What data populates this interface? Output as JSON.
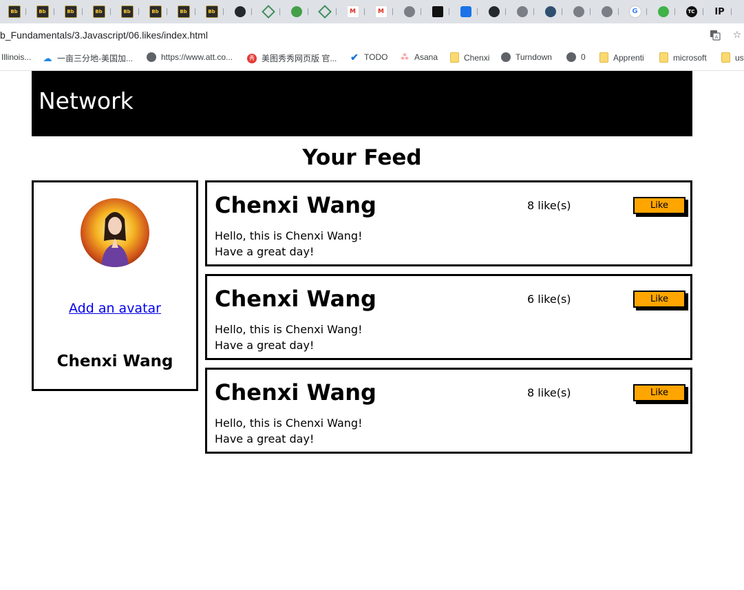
{
  "browser": {
    "tabs": [
      {
        "icon": "blackboard-icon",
        "label": "Bb"
      },
      {
        "icon": "blackboard-icon",
        "label": "Bb"
      },
      {
        "icon": "blackboard-icon",
        "label": "Bb"
      },
      {
        "icon": "blackboard-icon",
        "label": "Bb"
      },
      {
        "icon": "blackboard-icon",
        "label": "Bb"
      },
      {
        "icon": "blackboard-icon",
        "label": "Bb"
      },
      {
        "icon": "blackboard-icon",
        "label": "Bb"
      },
      {
        "icon": "blackboard-icon",
        "label": "Bb"
      },
      {
        "icon": "github-icon",
        "label": ""
      },
      {
        "icon": "diamond-icon",
        "label": ""
      },
      {
        "icon": "green-circle-icon",
        "label": ""
      },
      {
        "icon": "diamond-icon",
        "label": ""
      },
      {
        "icon": "gmail-icon",
        "label": "M"
      },
      {
        "icon": "gmail-icon",
        "label": "M"
      },
      {
        "icon": "globe-icon",
        "label": ""
      },
      {
        "icon": "black-square-icon",
        "label": ""
      },
      {
        "icon": "blue-stack-icon",
        "label": ""
      },
      {
        "icon": "github-icon",
        "label": ""
      },
      {
        "icon": "globe-icon",
        "label": ""
      },
      {
        "icon": "earth-icon",
        "label": ""
      },
      {
        "icon": "globe-icon",
        "label": ""
      },
      {
        "icon": "globe-icon",
        "label": ""
      },
      {
        "icon": "google-icon",
        "label": "G"
      },
      {
        "icon": "lime-circle-icon",
        "label": ""
      },
      {
        "icon": "tc-icon",
        "label": "TC"
      },
      {
        "icon": "ip-icon",
        "label": "IP"
      },
      {
        "icon": "checkmark-icon",
        "label": "✓"
      }
    ],
    "url": "b_Fundamentals/3.Javascript/06.likes/index.html",
    "bookmarks": [
      {
        "label": "Illinois...",
        "icon": "none"
      },
      {
        "label": "一亩三分地-美国加...",
        "icon": "cloud"
      },
      {
        "label": "https://www.att.co...",
        "icon": "globe"
      },
      {
        "label": "美图秀秀网页版 官...",
        "icon": "red"
      },
      {
        "label": "TODO",
        "icon": "check"
      },
      {
        "label": "Asana",
        "icon": "asana"
      },
      {
        "label": "Chenxi",
        "icon": "folder"
      },
      {
        "label": "Turndown",
        "icon": "globe"
      },
      {
        "label": "0",
        "icon": "globe"
      },
      {
        "label": "Apprenti",
        "icon": "folder"
      },
      {
        "label": "microsoft",
        "icon": "folder"
      },
      {
        "label": "us",
        "icon": "folder"
      }
    ]
  },
  "page": {
    "brand": "Network",
    "feed_title": "Your Feed",
    "profile": {
      "avatar_link": "Add an avatar",
      "name": "Chenxi Wang"
    },
    "posts": [
      {
        "author": "Chenxi Wang",
        "likes": "8 like(s)",
        "like_label": "Like",
        "line1": "Hello, this is Chenxi Wang!",
        "line2": "Have a great day!"
      },
      {
        "author": "Chenxi Wang",
        "likes": "6 like(s)",
        "like_label": "Like",
        "line1": "Hello, this is Chenxi Wang!",
        "line2": "Have a great day!"
      },
      {
        "author": "Chenxi Wang",
        "likes": "8 like(s)",
        "like_label": "Like",
        "line1": "Hello, this is Chenxi Wang!",
        "line2": "Have a great day!"
      }
    ]
  },
  "colors": {
    "navbar": "#000000",
    "like_button": "#ffa500",
    "link": "#0000ee"
  }
}
